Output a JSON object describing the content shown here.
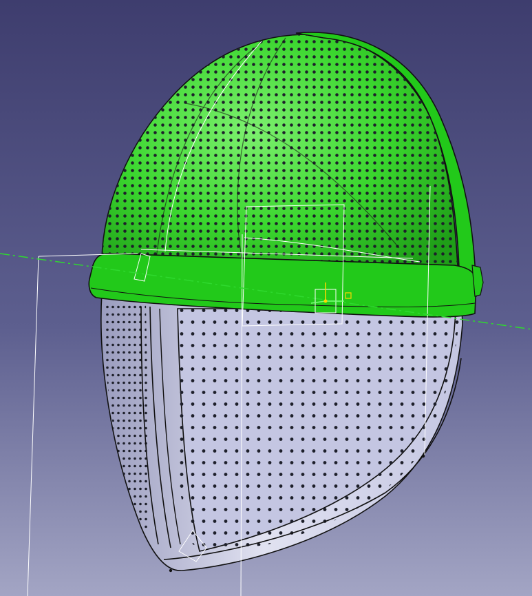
{
  "viewport": {
    "background_top": "#3e3d6e",
    "background_mid": "#5d5f8f",
    "background_bottom": "#a3a5c4"
  },
  "model": {
    "upper_shell_color": "#3ad62e",
    "upper_shell_highlight": "#7df06f",
    "upper_shell_shadow": "#1f9e18",
    "rim_color": "#22c91a",
    "mask_color": "#c4c6e2",
    "mask_shadow": "#9a9cbe",
    "mask_highlight": "#e1e2f1",
    "hole_color": "#1d1f2a",
    "edge_color": "#111111"
  },
  "overlay": {
    "wireframe_color": "#ffffff",
    "axis_color": "#2fd92f",
    "compass_color": "#ffd800",
    "compass_secondary": "#7dff7d"
  },
  "icons": {
    "compass": "robot-compass-icon"
  }
}
